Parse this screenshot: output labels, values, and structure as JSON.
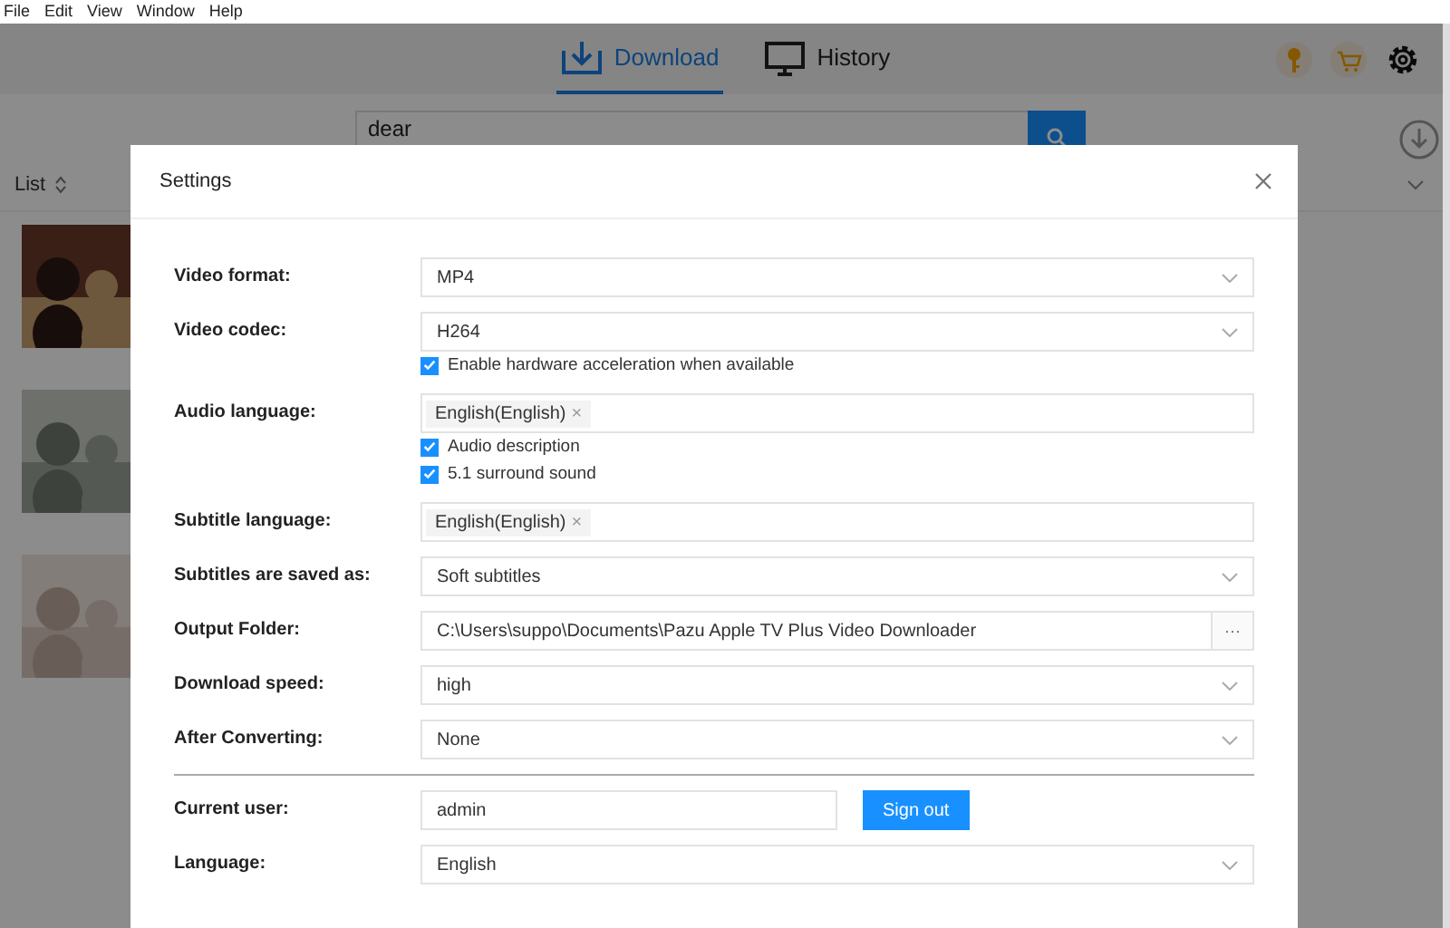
{
  "menu": [
    "File",
    "Edit",
    "View",
    "Window",
    "Help"
  ],
  "tabs": [
    {
      "label": "Download",
      "selected": true
    },
    {
      "label": "History",
      "selected": false
    }
  ],
  "search": {
    "value": "dear"
  },
  "list_header": {
    "label": "List"
  },
  "settings": {
    "title": "Settings",
    "rows": [
      {
        "kind": "select",
        "label": "Video format:",
        "value": "MP4"
      },
      {
        "kind": "select",
        "label": "Video codec:",
        "value": "H264",
        "options": [
          {
            "label": "Enable hardware acceleration when available",
            "checked": true
          }
        ]
      },
      {
        "kind": "tags",
        "label": "Audio language:",
        "tags": [
          {
            "label": "English(English)",
            "remove": "×"
          }
        ],
        "options": [
          {
            "label": "Audio description",
            "checked": true
          },
          {
            "label": "5.1 surround sound",
            "checked": true
          }
        ]
      },
      {
        "kind": "tags",
        "label": "Subtitle language:",
        "tags": [
          {
            "label": "English(English)",
            "remove": "×"
          }
        ]
      },
      {
        "kind": "select",
        "label": "Subtitles are saved as:",
        "value": "Soft subtitles"
      },
      {
        "kind": "path",
        "label": "Output Folder:",
        "value": "C:\\Users\\suppo\\Documents\\Pazu Apple TV Plus Video Downloader",
        "button": "···"
      },
      {
        "kind": "select",
        "label": "Download speed:",
        "value": "high"
      },
      {
        "kind": "select",
        "label": "After Converting:",
        "value": "None"
      }
    ],
    "account_rows": [
      {
        "kind": "user",
        "label": "Current user:",
        "value": "admin",
        "button": "Sign out"
      },
      {
        "kind": "select",
        "label": "Language:",
        "value": "English"
      }
    ]
  }
}
